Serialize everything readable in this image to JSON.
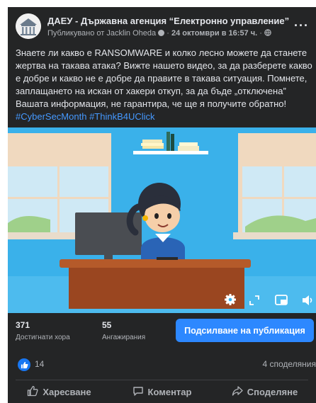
{
  "post": {
    "page_name": "ДАЕУ - Държавна агенция “Електронно управление”",
    "published_by": "Публикувано от Jacklin Oheda",
    "date": "24 октомври в 16:57 ч.",
    "more_label": "···",
    "text": "Знаете ли какво е RANSOMWARE и колко лесно можете да станете жертва на такава атака? Вижте нашето видео, за да разберете какво е добре и какво не е добре да правите в такава ситуация. Помнете, заплащането на искан от хакери откуп, за да бъде „отключена” Вашата информация, не гарантира, че ще я получите обратно!",
    "hashtags": [
      "#CyberSecMonth",
      "#ThinkB4UClick"
    ]
  },
  "stats": {
    "reach_value": "371",
    "reach_label": "Достигнати хора",
    "engagement_value": "55",
    "engagement_label": "Ангажирания",
    "boost_label": "Подсилване на публикация"
  },
  "reactions": {
    "like_count": "14",
    "shares": "4 споделяния"
  },
  "actions": {
    "like": "Харесване",
    "comment": "Коментар",
    "share": "Споделяне"
  },
  "icons": {
    "avatar": "building-logo",
    "privacy": "globe-icon",
    "like_badge": "thumbs-up-icon",
    "video_controls": [
      "gear-icon",
      "expand-icon",
      "miniplayer-icon",
      "volume-icon"
    ]
  },
  "colors": {
    "background": "#242526",
    "accent": "#2d88ff",
    "hashtag": "#4599ff"
  }
}
